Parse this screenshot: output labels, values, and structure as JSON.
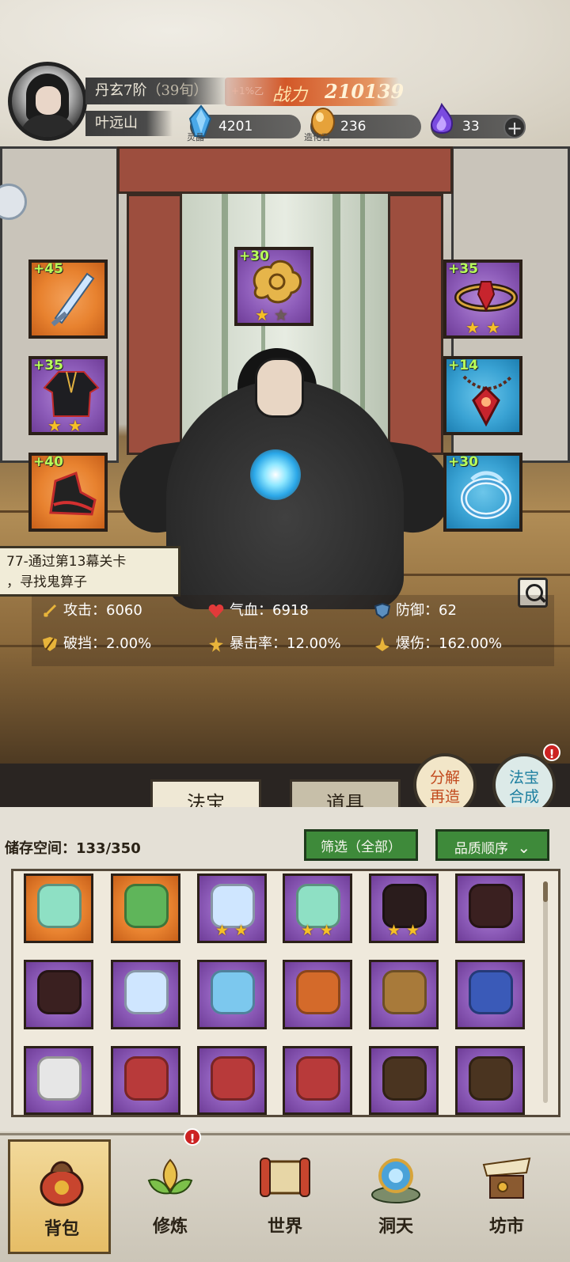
{
  "player": {
    "realm": "丹玄7阶",
    "age": "（39旬）",
    "name": "叶远山",
    "power_tag": "+1%乙",
    "power_label": "战力",
    "power_value": "210139"
  },
  "resources": [
    {
      "name": "灵晶",
      "value": "4201",
      "icon": "blue-crystal-icon",
      "color": "#4aa8e8"
    },
    {
      "name": "造化石",
      "value": "236",
      "icon": "gold-stone-icon",
      "color": "#e6a23a"
    },
    {
      "name": "",
      "value": "33",
      "icon": "purple-flame-icon",
      "color": "#7a4be0"
    }
  ],
  "equipment": [
    {
      "slot": "left-1",
      "plus": "+45",
      "quality": "orange",
      "icon": "sword-icon",
      "stars": 0,
      "max_stars": 0
    },
    {
      "slot": "top-center",
      "plus": "+30",
      "quality": "purple",
      "icon": "golden-cloud-icon",
      "stars": 1,
      "max_stars": 2
    },
    {
      "slot": "right-1",
      "plus": "+35",
      "quality": "purple",
      "icon": "crown-ring-icon",
      "stars": 2,
      "max_stars": 2
    },
    {
      "slot": "left-2",
      "plus": "+35",
      "quality": "purple",
      "icon": "dark-robe-icon",
      "stars": 2,
      "max_stars": 2
    },
    {
      "slot": "right-2",
      "plus": "+14",
      "quality": "blue",
      "icon": "red-pendant-icon",
      "stars": 0,
      "max_stars": 0
    },
    {
      "slot": "left-3",
      "plus": "+40",
      "quality": "orange",
      "icon": "red-boots-icon",
      "stars": 0,
      "max_stars": 0
    },
    {
      "slot": "right-3",
      "plus": "+30",
      "quality": "blue",
      "icon": "water-ring-icon",
      "stars": 0,
      "max_stars": 0
    }
  ],
  "quest": {
    "line1": "77-通过第13幕关卡",
    "line2": "，寻找鬼算子"
  },
  "stats": [
    {
      "label": "攻击：",
      "value": "6060",
      "icon": "sword-stat-icon"
    },
    {
      "label": "气血：",
      "value": "6918",
      "icon": "heart-icon"
    },
    {
      "label": "防御：",
      "value": "62",
      "icon": "shield-icon"
    },
    {
      "label": "破挡：",
      "value": "2.00%",
      "icon": "break-guard-icon"
    },
    {
      "label": "暴击率：",
      "value": "12.00%",
      "icon": "crit-rate-icon"
    },
    {
      "label": "爆伤：",
      "value": "162.00%",
      "icon": "crit-damage-icon"
    }
  ],
  "tabs": [
    {
      "label": "法宝"
    },
    {
      "label": "道具"
    }
  ],
  "actions": {
    "decompose_line1": "分解",
    "decompose_line2": "再造",
    "synth_line1": "法宝",
    "synth_line2": "合成",
    "synth_badge": "!"
  },
  "inventory": {
    "storage_label": "储存空间：",
    "storage_value": "133/350",
    "filter_label": "筛选（全部）",
    "sort_label": "品质顺序",
    "items": [
      {
        "quality": "orange",
        "icon": "jade-fan-icon",
        "stars": 0
      },
      {
        "quality": "orange",
        "icon": "leaf-wreath-icon",
        "stars": 0
      },
      {
        "quality": "purple",
        "icon": "sword-icon",
        "stars": 2
      },
      {
        "quality": "purple",
        "icon": "jade-fan-icon",
        "stars": 2
      },
      {
        "quality": "purple",
        "icon": "red-boots-icon",
        "stars": 2
      },
      {
        "quality": "purple",
        "icon": "dark-wheel-icon",
        "stars": 0
      },
      {
        "quality": "purple",
        "icon": "dark-wheel-icon",
        "stars": 0
      },
      {
        "quality": "purple",
        "icon": "sword-icon",
        "stars": 0
      },
      {
        "quality": "purple",
        "icon": "water-bow-icon",
        "stars": 0
      },
      {
        "quality": "purple",
        "icon": "fire-axe-icon",
        "stars": 0
      },
      {
        "quality": "purple",
        "icon": "staff-icon",
        "stars": 0
      },
      {
        "quality": "purple",
        "icon": "blue-armor-icon",
        "stars": 0
      },
      {
        "quality": "purple",
        "icon": "white-robe-icon",
        "stars": 0
      },
      {
        "quality": "purple",
        "icon": "demon-mask-icon",
        "stars": 0
      },
      {
        "quality": "purple",
        "icon": "demon-mask-icon",
        "stars": 0
      },
      {
        "quality": "purple",
        "icon": "demon-mask-icon",
        "stars": 0
      },
      {
        "quality": "purple",
        "icon": "brown-robe-icon",
        "stars": 0
      },
      {
        "quality": "purple",
        "icon": "brown-robe-icon",
        "stars": 0
      }
    ]
  },
  "nav": [
    {
      "label": "背包",
      "icon": "bag-icon",
      "active": true,
      "badge": ""
    },
    {
      "label": "修炼",
      "icon": "lotus-icon",
      "active": false,
      "badge": "!"
    },
    {
      "label": "世界",
      "icon": "scroll-map-icon",
      "active": false,
      "badge": ""
    },
    {
      "label": "洞天",
      "icon": "portal-icon",
      "active": false,
      "badge": ""
    },
    {
      "label": "坊市",
      "icon": "market-icon",
      "active": false,
      "badge": ""
    }
  ]
}
